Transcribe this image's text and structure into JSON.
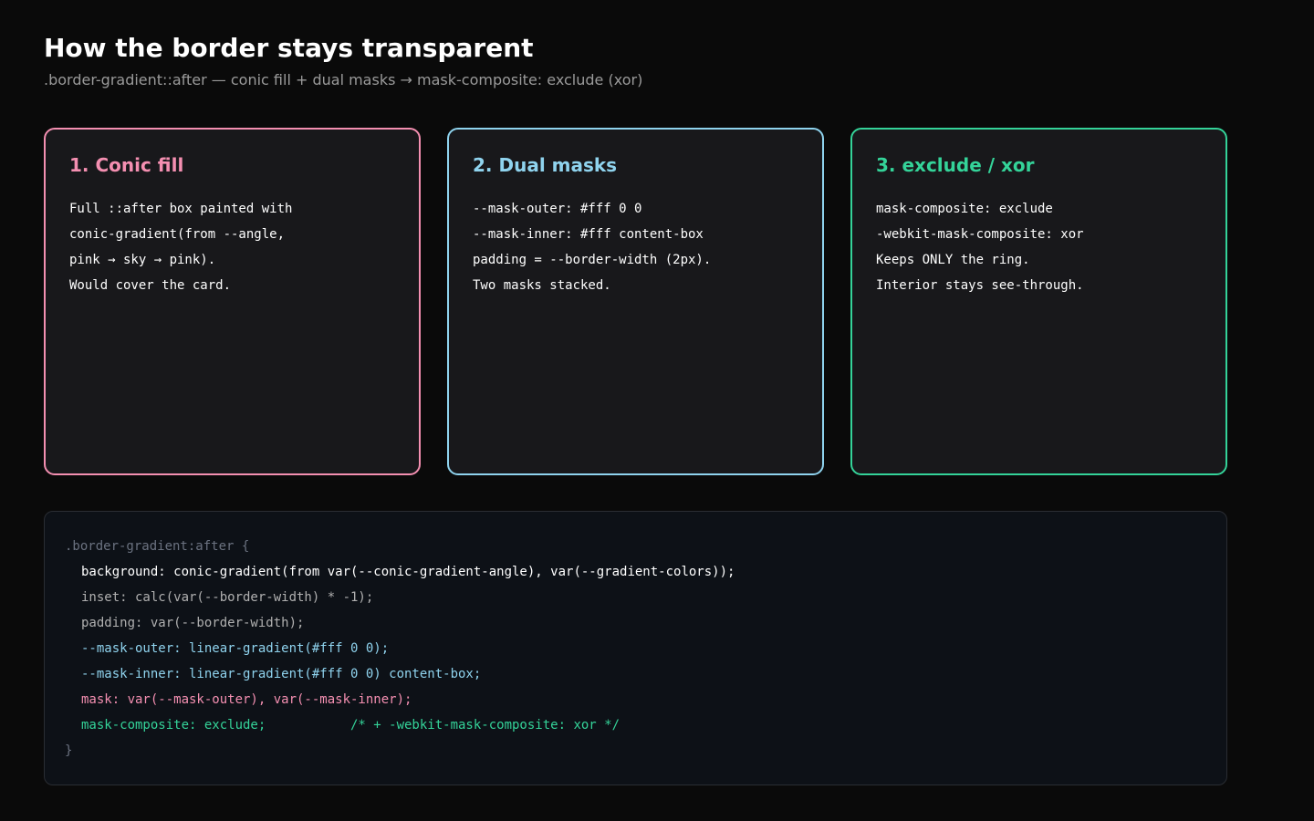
{
  "header": {
    "title": "How the border stays transparent",
    "subtitle": ".border-gradient::after — conic fill + dual masks → mask-composite: exclude (xor)"
  },
  "colors": {
    "pink": "#f48fb1",
    "sky": "#8fd3ee",
    "green": "#34d399",
    "muted": "#6b7280",
    "code_gray": "#b0b0b0"
  },
  "cards": [
    {
      "title": "1. Conic fill",
      "lines": [
        "Full ::after box painted with",
        "conic-gradient(from --angle,",
        "pink → sky → pink).",
        "Would cover the card."
      ]
    },
    {
      "title": "2. Dual masks",
      "lines": [
        "--mask-outer: #fff 0 0",
        "--mask-inner: #fff content-box",
        "padding = --border-width (2px).",
        "Two masks stacked."
      ]
    },
    {
      "title": "3. exclude / xor",
      "lines": [
        "mask-composite: exclude",
        "-webkit-mask-composite: xor",
        "Keeps ONLY the ring.",
        "Interior stays see-through."
      ]
    }
  ],
  "code": {
    "lines": [
      ".border-gradient:after {",
      "background: conic-gradient(from var(--conic-gradient-angle), var(--gradient-colors));",
      "inset: calc(var(--border-width) * -1);",
      "padding: var(--border-width);",
      "--mask-outer: linear-gradient(#fff 0 0);",
      "--mask-inner: linear-gradient(#fff 0 0) content-box;",
      "mask: var(--mask-outer), var(--mask-inner);",
      "mask-composite: exclude;           /* + -webkit-mask-composite: xor */",
      "}"
    ]
  }
}
